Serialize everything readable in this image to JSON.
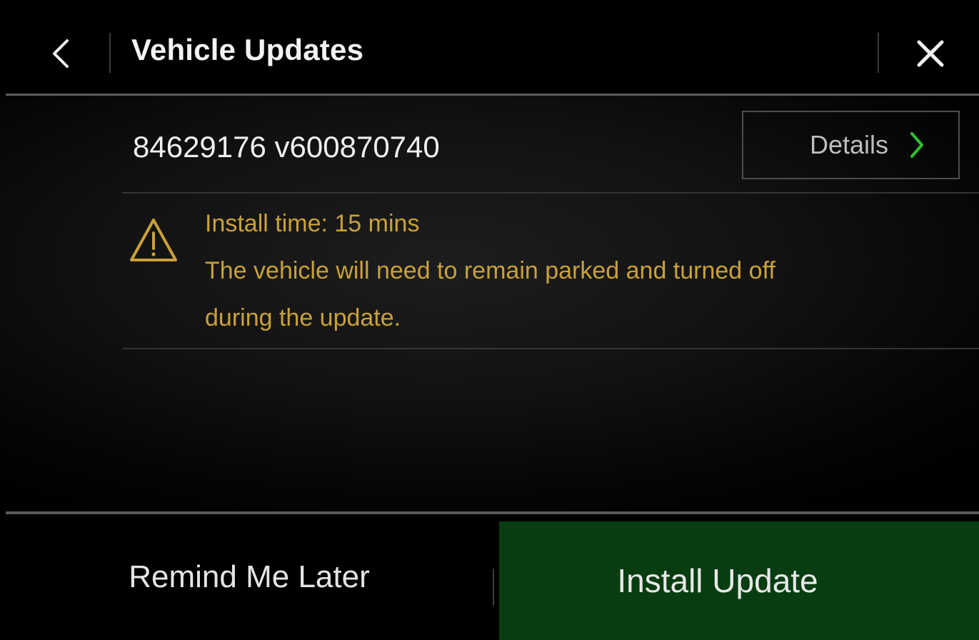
{
  "header": {
    "title": "Vehicle Updates",
    "back_icon": "chevron-left-icon",
    "close_icon": "close-icon"
  },
  "update": {
    "version": "84629176 v600870740",
    "details_label": "Details",
    "details_icon": "chevron-right-icon",
    "details_icon_color": "#2ec02e"
  },
  "warning": {
    "icon": "warning-triangle-icon",
    "color": "#c9a13a",
    "line1": "Install time: 15 mins",
    "line2": "The vehicle will need to remain parked and turned off",
    "line3": "during the update."
  },
  "actions": {
    "remind_label": "Remind Me Later",
    "install_label": "Install Update",
    "install_color": "#083d12"
  }
}
